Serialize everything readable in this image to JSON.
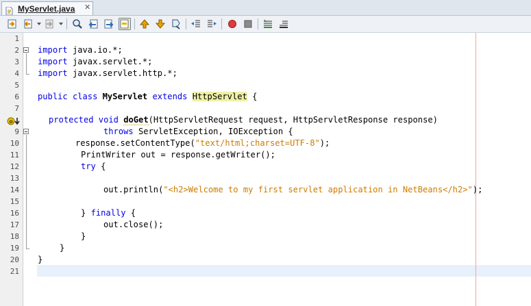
{
  "tab": {
    "title": "MyServlet.java",
    "close": "✕"
  },
  "toolbar": {
    "buttons": [
      "last-edit-icon",
      "back-icon",
      "forward-icon",
      "find-icon",
      "find-previous-icon",
      "find-next-icon",
      "toggle-highlight-icon",
      "previous-bookmark-icon",
      "next-bookmark-icon",
      "toggle-bookmark-icon",
      "shift-left-icon",
      "shift-right-icon",
      "start-macro-icon",
      "stop-macro-icon",
      "comment-icon",
      "uncomment-icon"
    ]
  },
  "gutter": {
    "line_numbers": [
      "1",
      "2",
      "3",
      "4",
      "5",
      "6",
      "7",
      "8",
      "9",
      "10",
      "11",
      "12",
      "13",
      "14",
      "15",
      "16",
      "17",
      "18",
      "19",
      "20",
      "21"
    ]
  },
  "code": {
    "l2_kw": "import",
    "l2_rest": " java.io.*;",
    "l3_kw": "import",
    "l3_rest": " javax.servlet.*;",
    "l4_kw": "import",
    "l4_rest": " javax.servlet.http.*;",
    "l6_kw1": "public class",
    "l6_sp1": " ",
    "l6_cls": "MyServlet",
    "l6_sp2": " ",
    "l6_kw2": "extends",
    "l6_sp3": " ",
    "l6_super": "HttpServlet",
    "l6_rest": " {",
    "l8_kw": "protected void",
    "l8_sp": " ",
    "l8_method": "doGet",
    "l8_rest": "(HttpServletRequest request, HttpServletResponse response)",
    "l9_kw": "throws",
    "l9_rest": " ServletException, IOException {",
    "l10_a": "response.setContentType(",
    "l10_str": "\"text/html;charset=UTF-8\"",
    "l10_b": ");",
    "l11": "PrintWriter out = response.getWriter();",
    "l12_kw": "try",
    "l12_rest": " {",
    "l14_a": "out.println(",
    "l14_str": "\"<h2>Welcome to my first servlet application in NetBeans</h2>\"",
    "l14_b": ");",
    "l16_a": "} ",
    "l16_kw": "finally",
    "l16_b": " {",
    "l17": "out.close();",
    "l18": "}",
    "l19": "}",
    "l20": "}"
  },
  "colors": {
    "keyword": "#0000e6",
    "string": "#ce7b00",
    "highlight": "#eef0a6",
    "current_line": "#e8f0fb",
    "right_margin": "#f3a3a3"
  }
}
